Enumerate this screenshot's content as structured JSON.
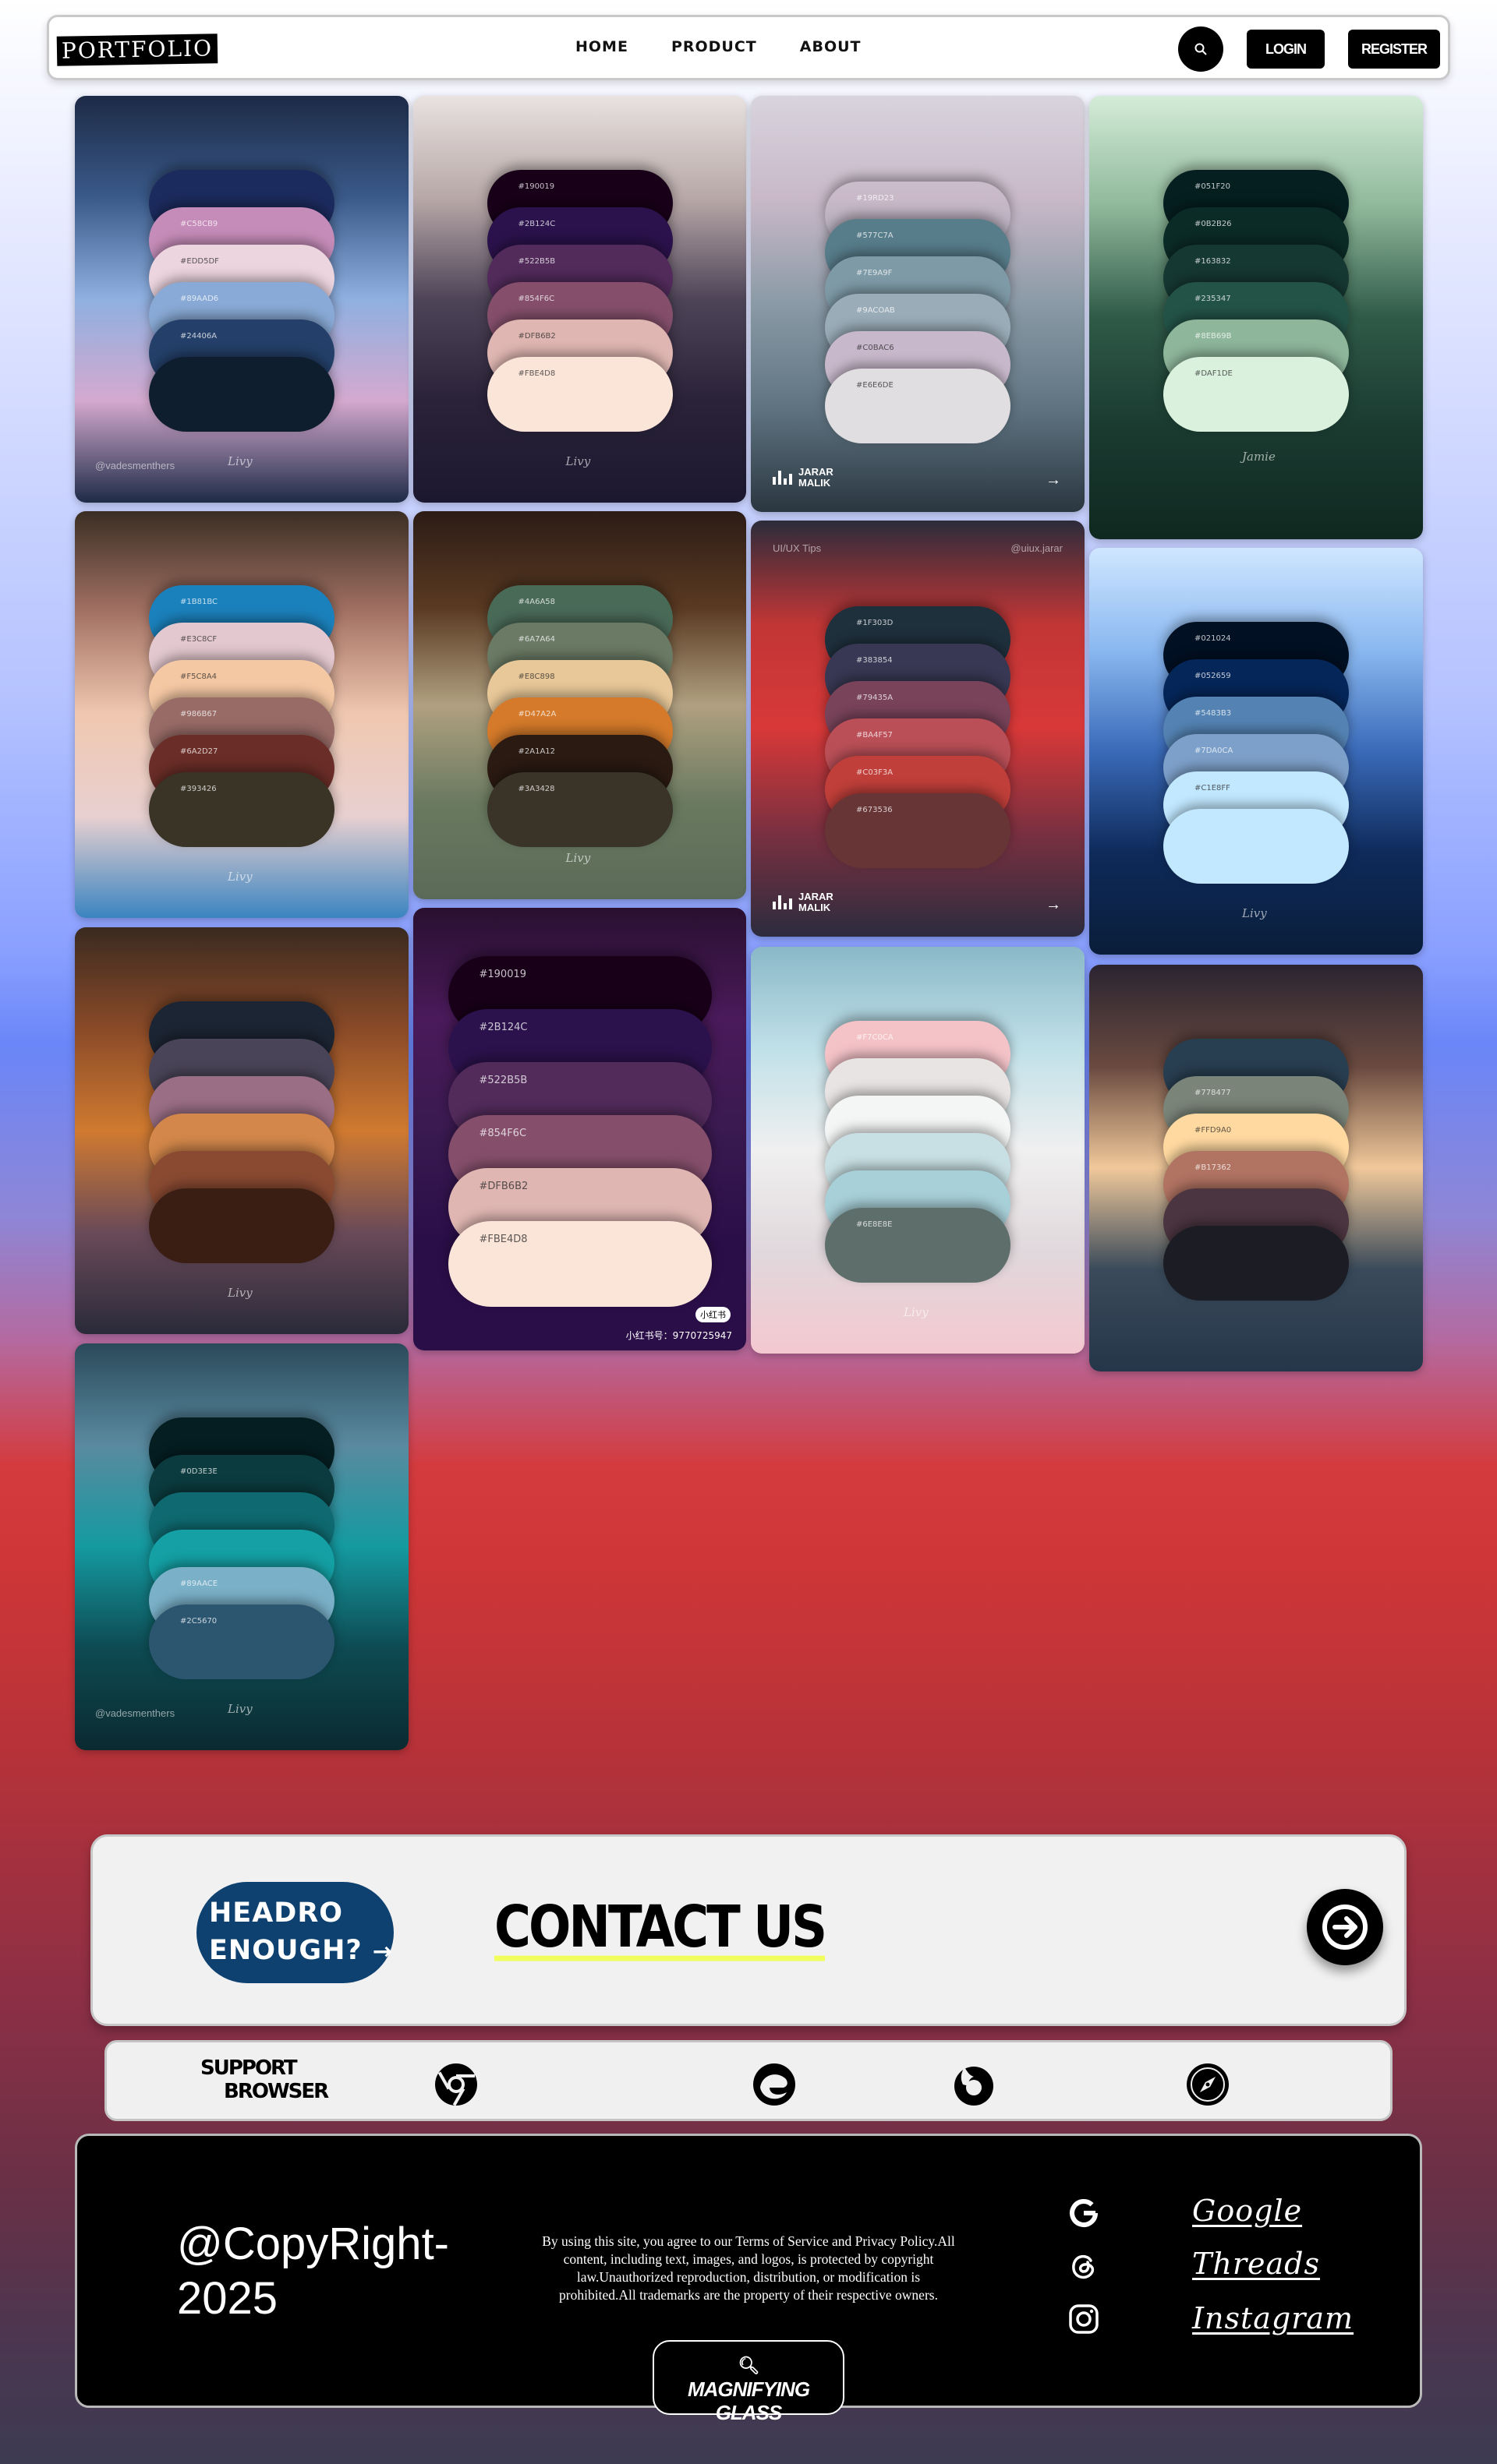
{
  "nav": {
    "logo": "PORTFOLIO",
    "links": [
      "HOME",
      "PRODUCT",
      "ABOUT"
    ],
    "login": "LOGIN",
    "register": "REGISTER"
  },
  "cards": [
    {
      "bg": [
        "#1d2a46",
        "#3a5a8a",
        "#8fb0e0",
        "#d4a9cf",
        "#1e2b47"
      ],
      "colors": [
        "#1c2b5e",
        "#c58cb9",
        "#edd5df",
        "#89aad6",
        "#24406a",
        "#0e1e2e"
      ],
      "hex": [
        "",
        "#C58CB9",
        "#EDD5DF",
        "#89AAD6",
        "#24406A",
        ""
      ],
      "foot": "@vadesmenthers",
      "sig": "Livy"
    },
    {
      "bg": [
        "#e8e2e0",
        "#b8a8a8",
        "#4e4458",
        "#2a2238",
        "#1c1830"
      ],
      "colors": [
        "#190019",
        "#2b124c",
        "#522b5b",
        "#854f6c",
        "#dfb6b2",
        "#fbe4d8"
      ],
      "hex": [
        "#190019",
        "#2B124C",
        "#522B5B",
        "#854F6C",
        "#DFB6B2",
        "#FBE4D8"
      ],
      "foot": "",
      "sig": "Livy"
    },
    {
      "bg": [
        "#d8d4de",
        "#c8b8c8",
        "#8a9aa6",
        "#5f7481",
        "#2a3640"
      ],
      "colors": [
        "#19d23",
        "#577c8a",
        "#7e9aa6",
        "#9aacb8",
        "#c8b8cb",
        "#e0dee0"
      ],
      "hex": [
        "#19RD23",
        "#577C7A",
        "#7E9A9F",
        "#9ACOAB",
        "#C0BAC6",
        "#E6E6DE"
      ],
      "foot": "",
      "brand": "JARAR MALIK"
    },
    {
      "bg": [
        "#d4ecd8",
        "#8fb89a",
        "#2f5a48",
        "#1a3a30",
        "#0f2820"
      ],
      "colors": [
        "#051f20",
        "#0b2b26",
        "#163832",
        "#235347",
        "#8eb69b",
        "#daf1de"
      ],
      "hex": [
        "#051F20",
        "#0B2B26",
        "#163832",
        "#235347",
        "#8EB69B",
        "#DAF1DE"
      ],
      "foot": "",
      "sig": "Jamie"
    },
    {
      "bg": [
        "#3a2e24",
        "#a47264",
        "#f0c8b0",
        "#e8d0d0",
        "#3a84c0"
      ],
      "colors": [
        "#1b81bc",
        "#e3c8cf",
        "#f5c8a4",
        "#986b67",
        "#6a2d27",
        "#393426"
      ],
      "hex": [
        "#1B81BC",
        "#E3C8CF",
        "#F5C8A4",
        "#986B67",
        "#6A2D27",
        "#393426"
      ],
      "foot": "",
      "sig": "Livy"
    },
    {
      "bg": [
        "#2c1c16",
        "#5a3a22",
        "#b0a080",
        "#6a7a60",
        "#5a6a58"
      ],
      "colors": [
        "#4a6a58",
        "#6a7a64",
        "#e8c898",
        "#d47a2a",
        "#2a1a12",
        "#3a3428"
      ],
      "hex": [
        "#4A6A58",
        "#6A7A64",
        "#E8C898",
        "#D47A2A",
        "#2A1A12",
        "#3A3428"
      ],
      "foot": "",
      "sig": "Livy"
    },
    {
      "bg": [
        "#2c2c3a",
        "#c23636",
        "#d83838",
        "#7a3040",
        "#2c2c3e"
      ],
      "colors": [
        "#1f303d",
        "#383854",
        "#79435a",
        "#ba4f57",
        "#c03f3a",
        "#673536"
      ],
      "hex": [
        "#1F303D",
        "#383854",
        "#79435A",
        "#BA4F57",
        "#C03F3A",
        "#673536"
      ],
      "foot": "UI/UX Tips",
      "tag": "@uiux.jarar",
      "brand": "JARAR MALIK"
    },
    {
      "bg": [
        "#cfe6ff",
        "#8ab8f0",
        "#3a6ab8",
        "#0e2a5a",
        "#0a1e3a"
      ],
      "colors": [
        "#021024",
        "#052659",
        "#5483b3",
        "#7da0ca",
        "#c1e8ff",
        "#c1e8ff"
      ],
      "hex": [
        "#021024",
        "#052659",
        "#5483B3",
        "#7DA0CA",
        "#C1E8FF",
        ""
      ],
      "foot": "",
      "sig": "Livy"
    },
    {
      "bg": [
        "#3a2a20",
        "#8a4a28",
        "#d07a30",
        "#6a4a58",
        "#2a2a3a"
      ],
      "colors": [
        "#1c2533",
        "#4a4458",
        "#9a6e84",
        "#d3874a",
        "#8a4a32",
        "#3a1e14"
      ],
      "hex": [
        "",
        "",
        "",
        "",
        "",
        ""
      ],
      "foot": "",
      "sig": "Livy"
    },
    {
      "bg": [
        "#2a1030",
        "#4a1a5a",
        "#3a1a50",
        "#2a0e48",
        "#2a0e48"
      ],
      "colors": [
        "#190019",
        "#2b124c",
        "#522b5b",
        "#854f6c",
        "#dfb6b2",
        "#fbe4d8"
      ],
      "hex": [
        "#190019",
        "#2B124C",
        "#522B5B",
        "#854F6C",
        "#DFB6B2",
        "#FBE4D8"
      ],
      "foot": "",
      "xhs": "小红书号：9770725947",
      "badge": "小红书"
    },
    {
      "bg": [
        "#8ab8c8",
        "#c0e0e8",
        "#f0f0f0",
        "#e0d8dc",
        "#f4c8d0"
      ],
      "colors": [
        "#f4c3c8",
        "#e8e4e4",
        "#f4f6f6",
        "#c8e0e4",
        "#a8d0d8",
        "#5e6e6a"
      ],
      "hex": [
        "#F7C0CA",
        "",
        "",
        "",
        "",
        "#6E8E8E"
      ],
      "foot": "",
      "sig": "Livy"
    },
    {
      "bg": [
        "#2a2430",
        "#6a4a40",
        "#f0c89a",
        "#3a4a5a",
        "#26364a"
      ],
      "colors": [
        "#283e51",
        "#7a8478",
        "#ffd9a0",
        "#b17362",
        "#4b3540",
        "#1c1c24"
      ],
      "hex": [
        "",
        "#778477",
        "#FFD9A0",
        "#B17362",
        "",
        ""
      ],
      "foot": "",
      "sig": ""
    },
    {
      "bg": [
        "#2a4a5a",
        "#5a8aa0",
        "#149aa0",
        "#0e4a52",
        "#0a2a30"
      ],
      "colors": [
        "#041e22",
        "#0b3b3e",
        "#0e6a70",
        "#14a0a4",
        "#7ab0c8",
        "#2c5670"
      ],
      "hex": [
        "",
        "#0D3E3E",
        "",
        "",
        "#89AACE",
        "#2C5670"
      ],
      "foot": "@vadesmenthers",
      "sig": "Livy"
    }
  ],
  "contact": {
    "badge_line1": "HEADRO",
    "badge_line2": "ENOUGH?",
    "title": "CONTACT US"
  },
  "browsers": {
    "label_line1": "SUPPORT",
    "label_line2": "BROWSER",
    "items": [
      "chrome-icon",
      "edge-icon",
      "firefox-icon",
      "safari-icon"
    ]
  },
  "footer": {
    "copyright_line1": "@CopyRight-",
    "copyright_line2": "2025",
    "legal": "By using this site, you agree to our Terms of Service and Privacy Policy.All content, including text, images, and logos, is protected by copyright law.Unauthorized reproduction, distribution, or modification is prohibited.All trademarks are the property of their respective owners.",
    "mag_line1": "MAGNIFYING",
    "mag_line2": "GLASS",
    "social": [
      "Google",
      "Threads",
      "Instagram"
    ]
  }
}
